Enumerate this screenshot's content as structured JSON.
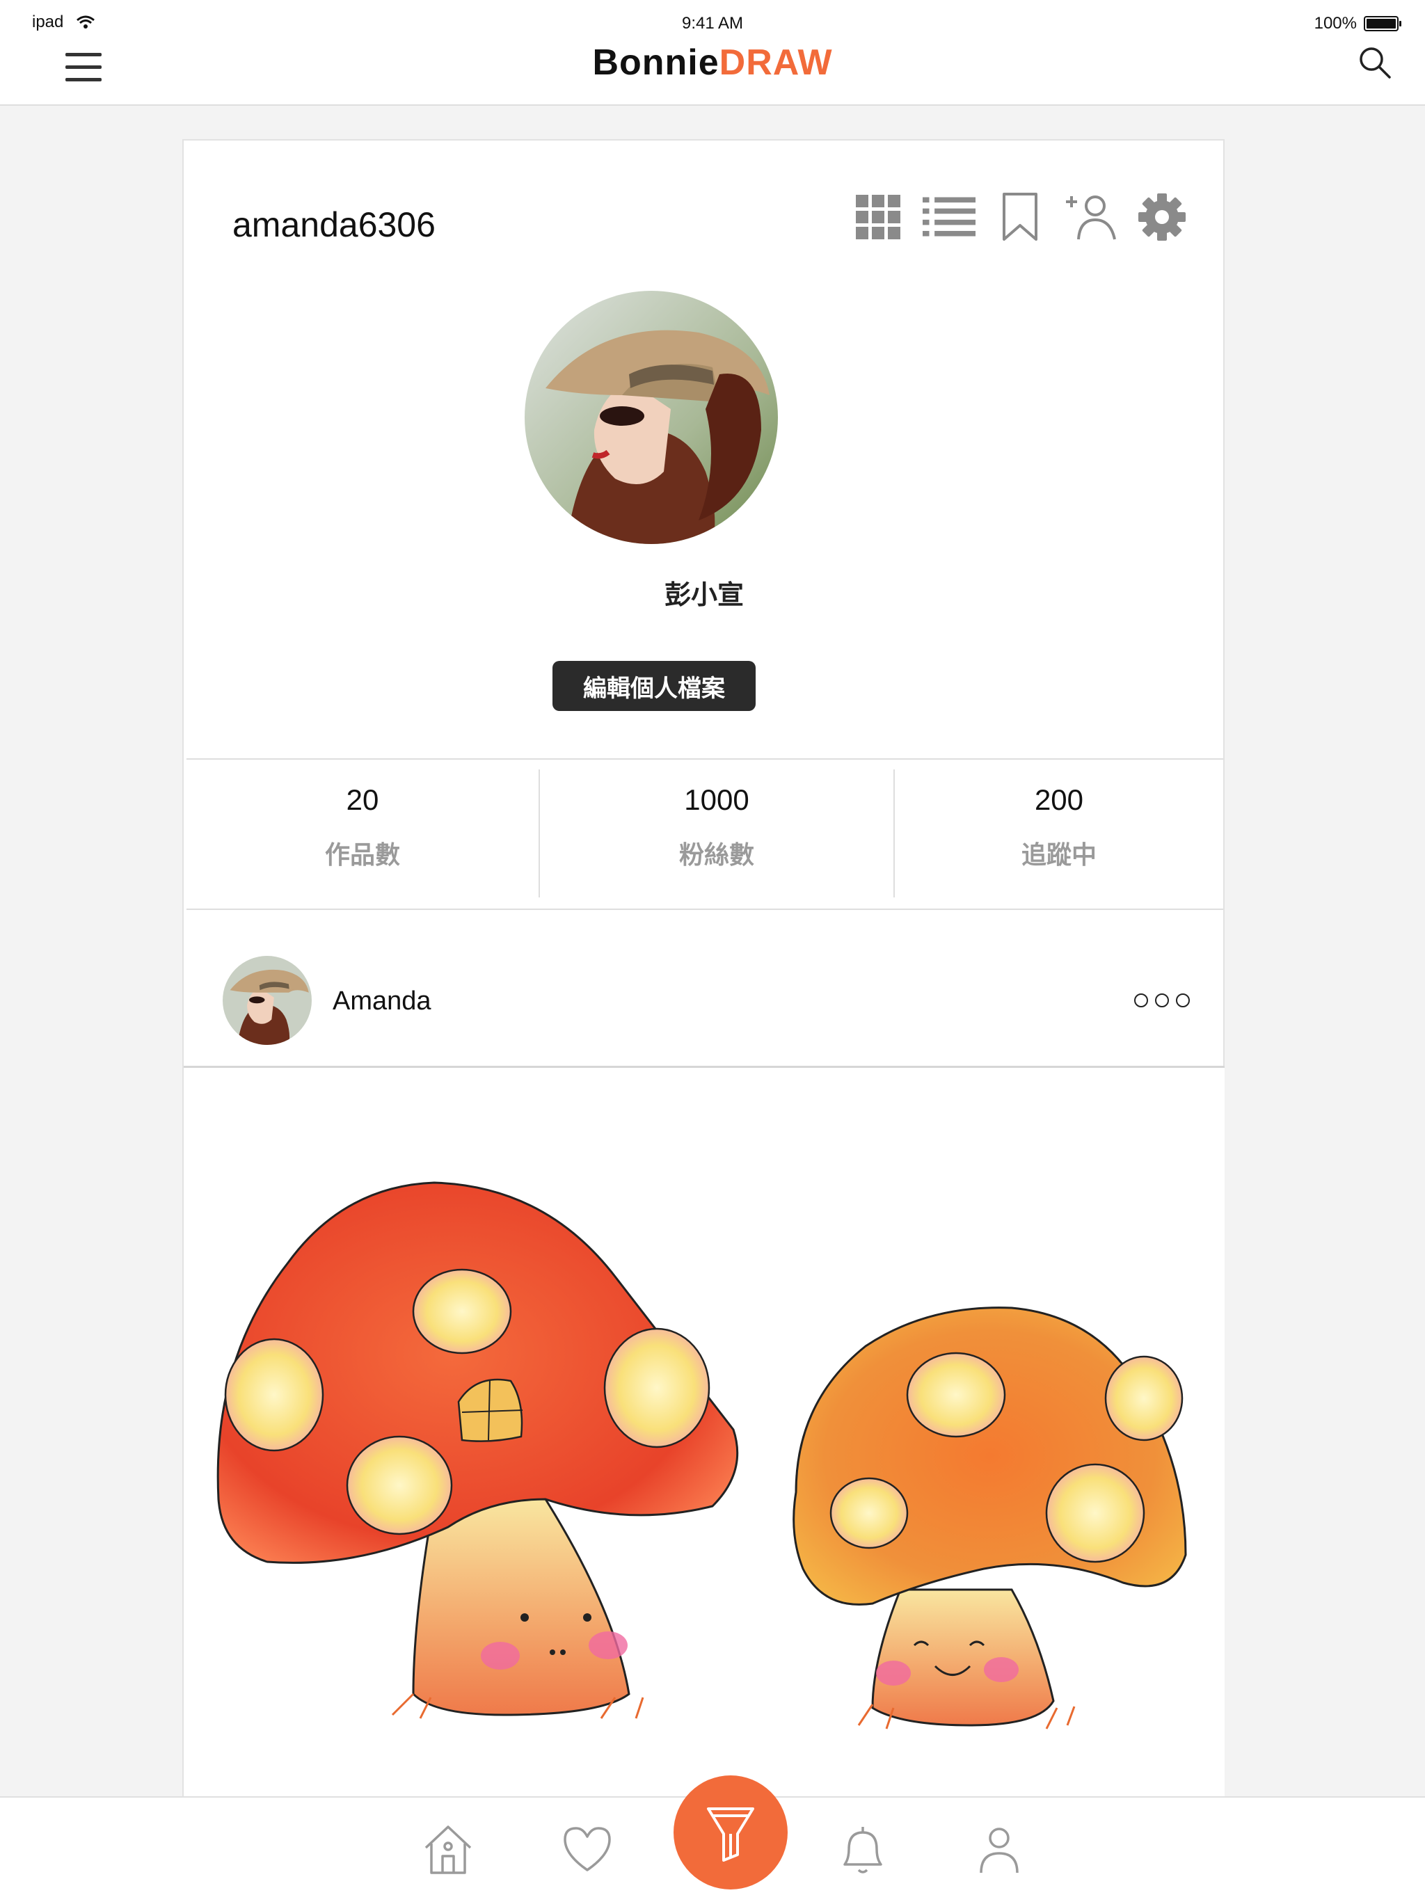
{
  "status_bar": {
    "device": "ipad",
    "time": "9:41 AM",
    "battery": "100%"
  },
  "header": {
    "logo_part1": "Bonnie",
    "logo_part2": "DRAW",
    "menu_icon": "hamburger-menu-icon",
    "search_icon": "search-icon"
  },
  "profile": {
    "username": "amanda6306",
    "display_name": "彭小宣",
    "edit_button": "編輯個人檔案",
    "toolbar_icons": [
      "grid-view-icon",
      "list-view-icon",
      "bookmark-icon",
      "add-friend-icon",
      "settings-icon"
    ]
  },
  "stats": [
    {
      "value": "20",
      "label": "作品數"
    },
    {
      "value": "1000",
      "label": "粉絲數"
    },
    {
      "value": "200",
      "label": "追蹤中"
    }
  ],
  "post": {
    "author": "Amanda",
    "more_icon": "more-options-icon",
    "image": "mushroom-drawing"
  },
  "bottom_nav": {
    "items": [
      "home-icon",
      "heart-icon",
      "create-draw-icon",
      "bell-icon",
      "profile-icon"
    ]
  },
  "colors": {
    "accent": "#f26b3a",
    "dark_button": "#2b2b2b",
    "muted_text": "#9a9a9a"
  }
}
